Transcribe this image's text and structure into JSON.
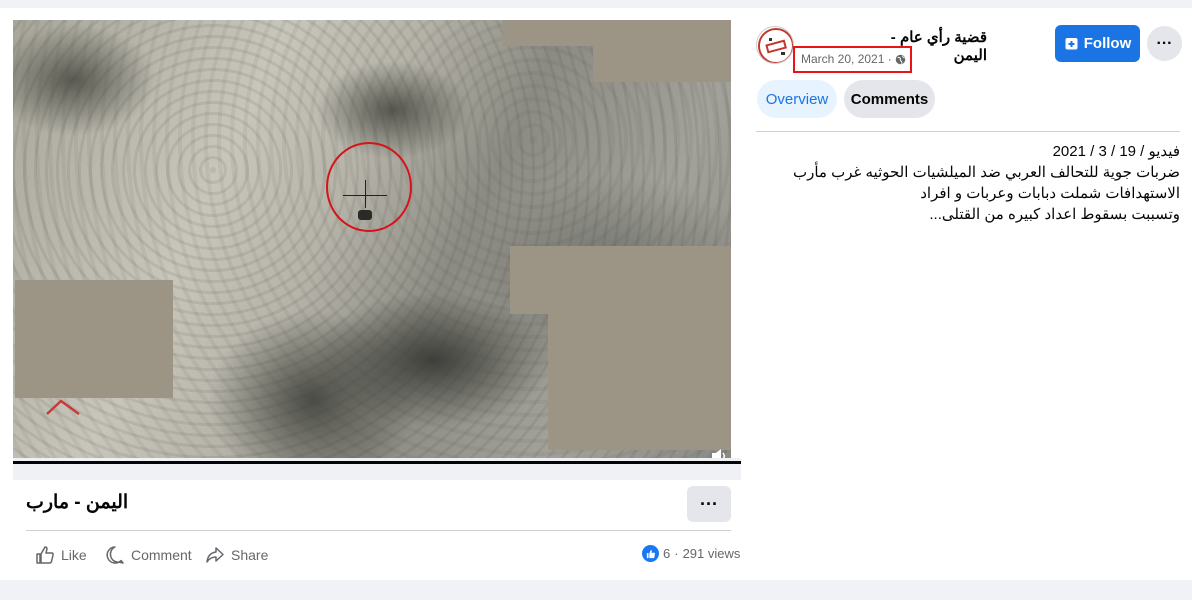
{
  "video": {
    "title": "اليمن - مارب",
    "more_label": "···"
  },
  "actions": {
    "like_label": "Like",
    "comment_label": "Comment",
    "share_label": "Share"
  },
  "stats": {
    "reactions": "6",
    "separator": " · ",
    "views": "291 views"
  },
  "page": {
    "name": "قضية رأي عام - اليمن",
    "date": "March 20, 2021 ·",
    "follow_label": "Follow",
    "more_label": "···"
  },
  "tabs": [
    {
      "label": "Overview",
      "active": true
    },
    {
      "label": "Comments",
      "active": false
    }
  ],
  "description": {
    "lines": [
      "فيديو / 19 / 3 / 2021",
      "ضربات جوية للتحالف العربي ضد الميلشيات الحوثيه غرب مأرب",
      "الاستهدافات شملت دبابات وعربات و افراد",
      "وتسببت بسقوط اعداد كبيره من القتلى..."
    ]
  },
  "colors": {
    "brand_blue": "#1b74e4",
    "highlight_red": "#e8141a",
    "muted_text": "#65676b"
  },
  "icons": {
    "like": "thumbs-up-icon",
    "comment": "speech-bubble-icon",
    "share": "share-arrow-icon",
    "globe": "globe-icon",
    "follow": "follow-page-icon",
    "volume": "volume-icon"
  }
}
